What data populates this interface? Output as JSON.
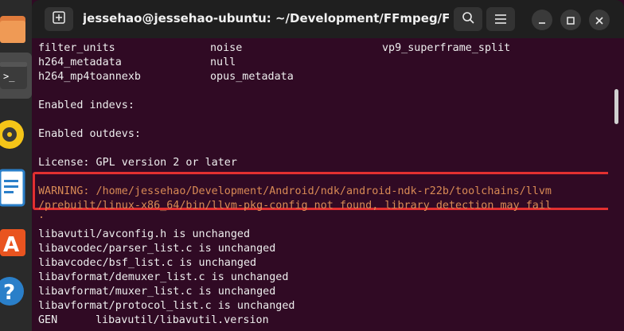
{
  "window": {
    "title": "jessehao@jessehao-ubuntu: ~/Development/FFmpeg/FFmpe..."
  },
  "titlebar": {
    "new_tab_icon": "new-tab-icon",
    "search_icon": "search-icon",
    "menu_icon": "hamburger-menu-icon",
    "minimize_icon": "minimize-icon",
    "maximize_icon": "maximize-icon",
    "close_icon": "close-icon"
  },
  "dock": {
    "items": [
      "files-icon",
      "terminal-icon",
      "rhythmbox-icon",
      "libreoffice-writer-icon",
      "software-center-icon",
      "help-icon"
    ]
  },
  "terminal": {
    "table_rows": [
      [
        "filter_units",
        "noise",
        "vp9_superframe_split"
      ],
      [
        "h264_metadata",
        "null",
        ""
      ],
      [
        "h264_mp4toannexb",
        "opus_metadata",
        ""
      ]
    ],
    "enabled_indevs": "Enabled indevs:",
    "enabled_outdevs": "Enabled outdevs:",
    "license": "License: GPL version 2 or later",
    "warning_line1": "WARNING: /home/jessehao/Development/Android/ndk/android-ndk-r22b/toolchains/llvm",
    "warning_line2": "/prebuilt/linux-x86_64/bin/llvm-pkg-config not found, library detection may fail",
    "warning_line3": ".",
    "unchanged": [
      "libavutil/avconfig.h is unchanged",
      "libavcodec/parser_list.c is unchanged",
      "libavcodec/bsf_list.c is unchanged",
      "libavformat/demuxer_list.c is unchanged",
      "libavformat/muxer_list.c is unchanged",
      "libavformat/protocol_list.c is unchanged"
    ],
    "gen_label": "GEN",
    "gen_value": "libavutil/libavutil.version"
  },
  "colors": {
    "terminal_bg": "#300a24",
    "text": "#eeeeee",
    "warning_text": "#d88a55",
    "highlight_box": "#e23030"
  }
}
